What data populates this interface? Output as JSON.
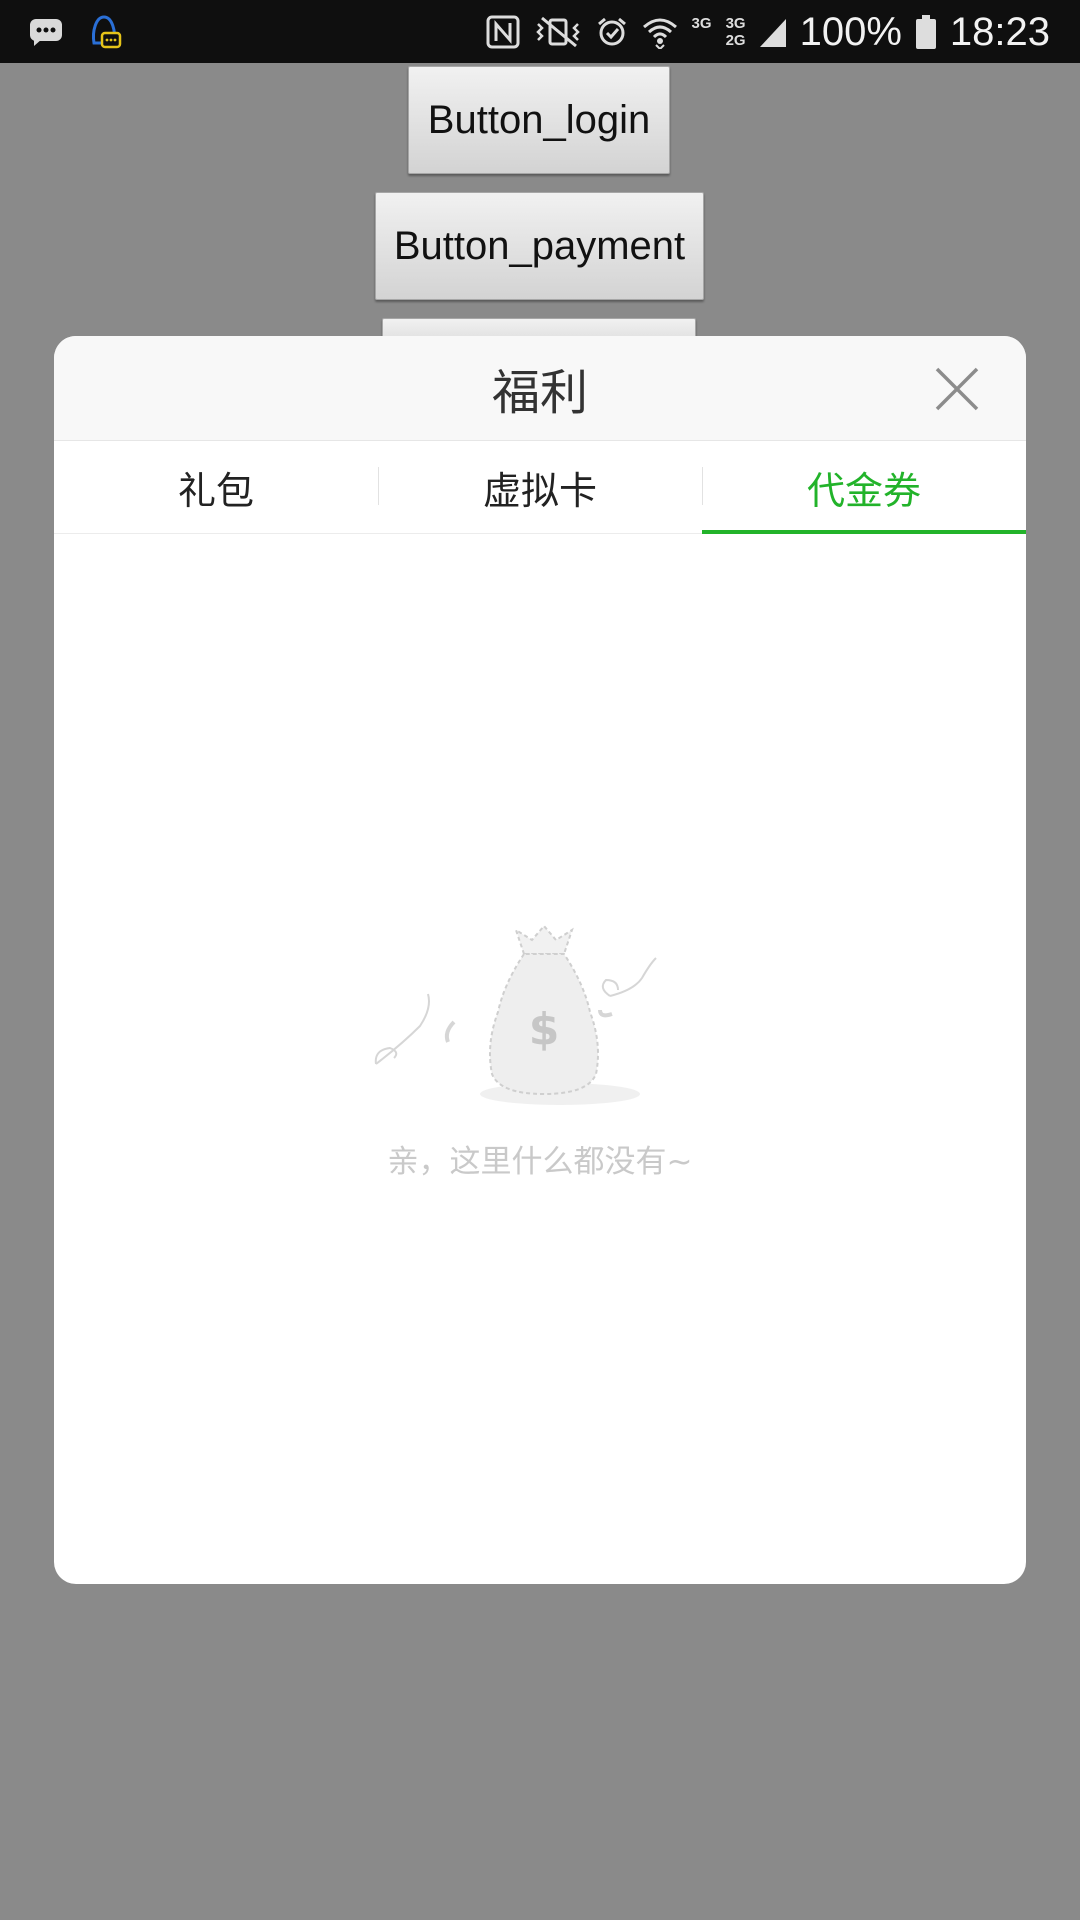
{
  "status_bar": {
    "battery": "100%",
    "time": "18:23",
    "network_top": "3G",
    "network_right_top": "3G",
    "network_right_bottom": "2G",
    "icons": [
      "message-icon",
      "qq-notification-icon",
      "nfc-icon",
      "vibrate-icon",
      "alarm-icon",
      "wifi-icon",
      "signal-icon",
      "battery-icon"
    ]
  },
  "background": {
    "button_login": "Button_login",
    "button_payment": "Button_payment"
  },
  "dialog": {
    "title": "福利",
    "tabs": [
      {
        "label": "礼包"
      },
      {
        "label": "虚拟卡"
      },
      {
        "label": "代金券"
      }
    ],
    "active_tab": "代金券",
    "empty_text": "亲，这里什么都没有~"
  },
  "colors": {
    "accent": "#22b32a",
    "overlay": "#8a8a8a",
    "status_bar": "#0f0f0f"
  }
}
